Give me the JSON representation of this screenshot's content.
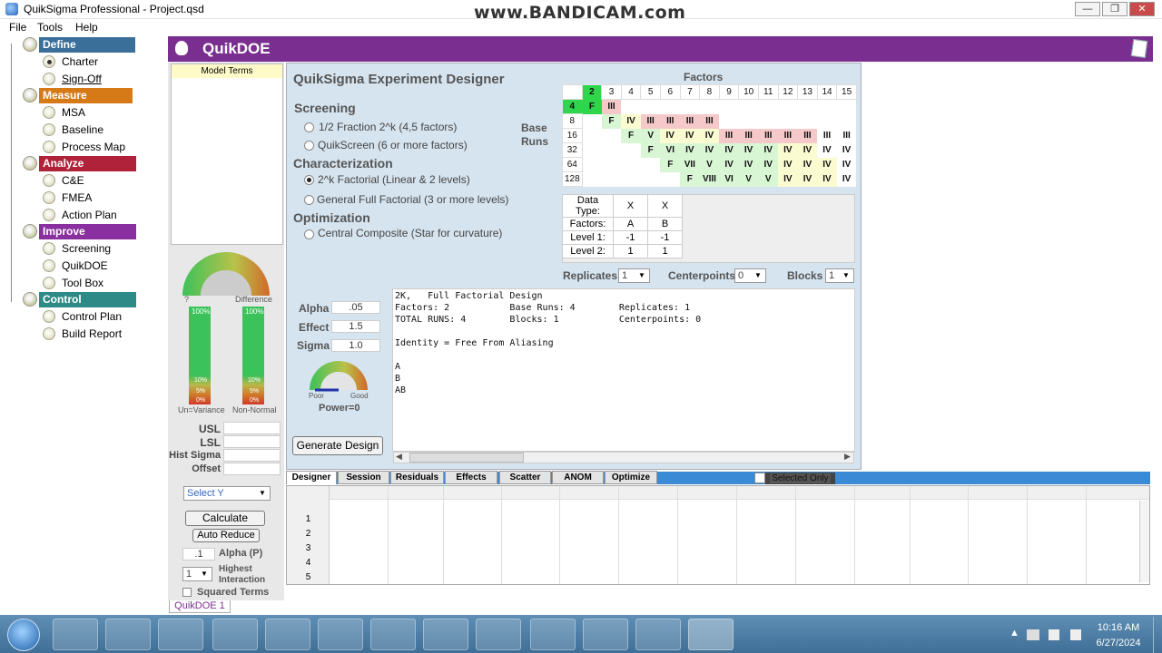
{
  "window": {
    "title": "QuikSigma Professional - Project.qsd",
    "watermark": "www.BANDICAM.com",
    "min": "—",
    "max": "❐",
    "close": "✕"
  },
  "menu": [
    "File",
    "Tools",
    "Help"
  ],
  "nav": {
    "phases": [
      {
        "label": "Define",
        "color": "#3a6f9a",
        "items": [
          "Charter",
          "Sign-Off"
        ]
      },
      {
        "label": "Measure",
        "color": "#d67a18",
        "items": [
          "MSA",
          "Baseline",
          "Process Map"
        ]
      },
      {
        "label": "Analyze",
        "color": "#b0223a",
        "items": [
          "C&E",
          "FMEA",
          "Action Plan"
        ]
      },
      {
        "label": "Improve",
        "color": "#8a2fa0",
        "items": [
          "Screening",
          "QuikDOE",
          "Tool Box"
        ]
      },
      {
        "label": "Control",
        "color": "#2e8a86",
        "items": [
          "Control Plan",
          "Build Report"
        ]
      }
    ]
  },
  "header": {
    "title": "QuikDOE"
  },
  "model_terms": {
    "header": "Model Terms"
  },
  "designer": {
    "title": "QuikSigma Experiment Designer",
    "screening": {
      "label": "Screening",
      "options": [
        "1/2 Fraction 2^k  (4,5 factors)",
        "QuikScreen  (6 or more factors)"
      ]
    },
    "characterization": {
      "label": "Characterization",
      "options": [
        "2^k Factorial  (Linear &  2 levels)",
        "General Full Factorial  (3 or more levels)"
      ]
    },
    "optimization": {
      "label": "Optimization",
      "options": [
        "Central Composite (Star for curvature)"
      ]
    },
    "factors_label": "Factors",
    "base_runs_label": "Base\nRuns",
    "factor_cols": [
      "2",
      "3",
      "4",
      "5",
      "6",
      "7",
      "8",
      "9",
      "10",
      "11",
      "12",
      "13",
      "14",
      "15"
    ],
    "factor_rows": [
      {
        "runs": "4",
        "cells": [
          "F",
          "III",
          "",
          "",
          "",
          "",
          "",
          "",
          "",
          "",
          "",
          "",
          "",
          ""
        ]
      },
      {
        "runs": "8",
        "cells": [
          "",
          "F",
          "IV",
          "III",
          "III",
          "III",
          "III",
          "",
          "",
          "",
          "",
          "",
          "",
          ""
        ]
      },
      {
        "runs": "16",
        "cells": [
          "",
          "",
          "F",
          "V",
          "IV",
          "IV",
          "IV",
          "III",
          "III",
          "III",
          "III",
          "III",
          "III",
          "III"
        ]
      },
      {
        "runs": "32",
        "cells": [
          "",
          "",
          "",
          "F",
          "VI",
          "IV",
          "IV",
          "IV",
          "IV",
          "IV",
          "IV",
          "IV",
          "IV",
          "IV"
        ]
      },
      {
        "runs": "64",
        "cells": [
          "",
          "",
          "",
          "",
          "F",
          "VII",
          "V",
          "IV",
          "IV",
          "IV",
          "IV",
          "IV",
          "IV",
          "IV"
        ]
      },
      {
        "runs": "128",
        "cells": [
          "",
          "",
          "",
          "",
          "",
          "F",
          "VIII",
          "VI",
          "V",
          "V",
          "IV",
          "IV",
          "IV",
          "IV"
        ]
      }
    ],
    "data_table": {
      "rows": [
        [
          "Data Type:",
          "X",
          "X"
        ],
        [
          "Factors:",
          "A",
          "B"
        ],
        [
          "Level 1:",
          "-1",
          "-1"
        ],
        [
          "Level 2:",
          "1",
          "1"
        ]
      ]
    },
    "replicates": {
      "label": "Replicates",
      "value": "1"
    },
    "centerpoints": {
      "label": "Centerpoints",
      "value": "0"
    },
    "blocks": {
      "label": "Blocks",
      "value": "1"
    },
    "alpha": {
      "label": "Alpha",
      "value": ".05"
    },
    "effect": {
      "label": "Effect",
      "value": "1.5"
    },
    "sigma": {
      "label": "Sigma",
      "value": "1.0"
    },
    "power_gauge": {
      "poor": "Poor",
      "good": "Good",
      "power": "Power=0"
    },
    "generate_button": "Generate Design",
    "output": "2K,   Full Factorial Design\nFactors: 2           Base Runs: 4        Replicates: 1\nTOTAL RUNS: 4        Blocks: 1           Centerpoints: 0\n\nIdentity = Free From Aliasing\n\nA\nB\nAB"
  },
  "left_tools": {
    "gauge": {
      "left": "?",
      "right": "Difference"
    },
    "bars": [
      {
        "top": "100%",
        "marks": [
          "10%",
          "5%",
          "0%"
        ],
        "label": "Un=Variance"
      },
      {
        "top": "100%",
        "marks": [
          "10%",
          "5%",
          "0%"
        ],
        "label": "Non-Normal"
      }
    ],
    "usl": "USL",
    "lsl": "LSL",
    "hist_sigma": "Hist Sigma",
    "offset": "Offset",
    "select_y": "Select Y",
    "calculate": "Calculate",
    "auto_reduce": "Auto Reduce",
    "alpha_p": {
      "value": ".1",
      "label": "Alpha (P)"
    },
    "highest": {
      "value": "1",
      "label": "Highest\nInteraction"
    },
    "squared": "Squared Terms"
  },
  "tabs": [
    "Designer",
    "Session",
    "Residuals",
    "Effects",
    "Scatter",
    "ANOM",
    "Optimize"
  ],
  "selected_only": "Selected Only",
  "grid_rows": [
    "1",
    "2",
    "3",
    "4",
    "5"
  ],
  "sheet_tab": "QuikDOE 1",
  "taskbar": {
    "time": "10:16 AM",
    "date": "6/27/2024"
  }
}
